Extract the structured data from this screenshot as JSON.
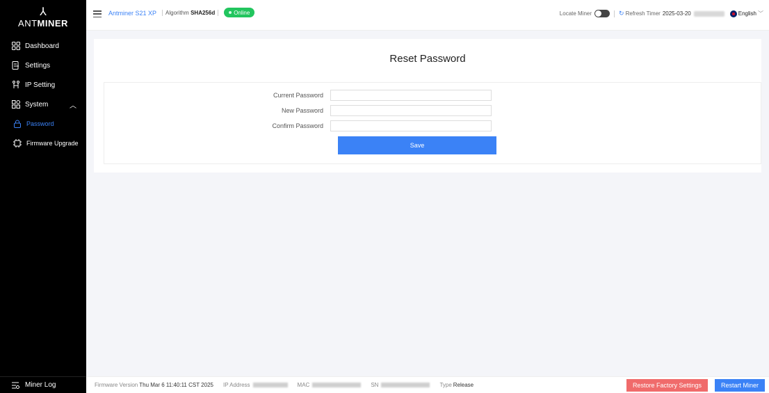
{
  "brand": {
    "logo_glyph": "⅄",
    "name_part1": "ANT",
    "name_part2": "MINER"
  },
  "sidebar": {
    "items": [
      {
        "label": "Dashboard",
        "icon": "grid-icon"
      },
      {
        "label": "Settings",
        "icon": "settings-doc-icon"
      },
      {
        "label": "IP Setting",
        "icon": "network-icon"
      },
      {
        "label": "System",
        "icon": "system-grid-icon"
      },
      {
        "label": "Password",
        "icon": "lock-icon"
      },
      {
        "label": "Firmware Upgrade",
        "icon": "firmware-icon"
      }
    ],
    "bottom_label": "Miner Log"
  },
  "header": {
    "model": "Antminer S21 XP",
    "algorithm_label": "Algorithm",
    "algorithm_value": "SHA256d",
    "status": "Online",
    "locate_label": "Locate Miner",
    "refresh_label": "Refresh Timer",
    "refresh_date": "2025-03-20",
    "language": "English"
  },
  "page": {
    "title": "Reset Password",
    "fields": [
      {
        "label": "Current Password",
        "value": ""
      },
      {
        "label": "New Password",
        "value": ""
      },
      {
        "label": "Confirm Password",
        "value": ""
      }
    ],
    "save_label": "Save"
  },
  "footer": {
    "firmware_label": "Firmware Version",
    "firmware_value": "Thu Mar 6 11:40:11 CST 2025",
    "ip_label": "IP Address",
    "mac_label": "MAC",
    "sn_label": "SN",
    "type_label": "Type",
    "type_value": "Release",
    "restore_label": "Restore Factory Settings",
    "restart_label": "Restart Miner"
  },
  "colors": {
    "accent": "#3b82f6",
    "online": "#22c55e",
    "danger": "#f06b6b",
    "sidebar": "#000000"
  }
}
